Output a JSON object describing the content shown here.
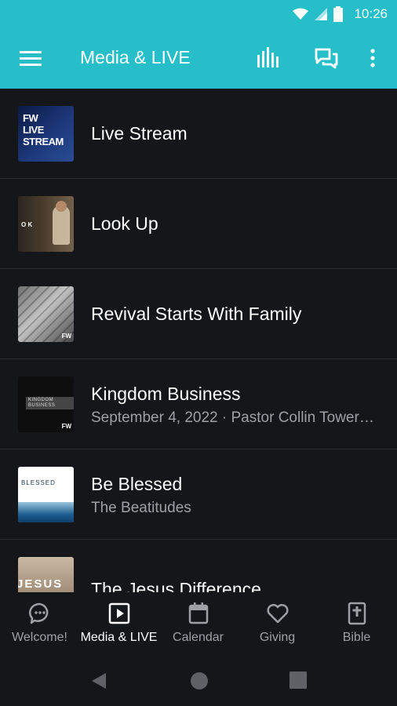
{
  "status_bar": {
    "time": "10:26"
  },
  "app_bar": {
    "title": "Media & LIVE"
  },
  "thumbnails": {
    "live_line1": "FW",
    "live_line2": "LIVE",
    "live_line3": "STREAM",
    "look_text": "O K",
    "fw": "FW",
    "kingdom_line1": "KINGDOM",
    "kingdom_line2": "BUSINESS",
    "blessed": "BLESSED",
    "jesus": "JESUS"
  },
  "items": [
    {
      "title": "Live Stream"
    },
    {
      "title": "Look Up"
    },
    {
      "title": "Revival Starts With Family"
    },
    {
      "title": "Kingdom Business",
      "subtitle": "September 4, 2022 · Pastor Collin Tower…"
    },
    {
      "title": "Be Blessed",
      "subtitle": "The Beatitudes"
    },
    {
      "title": "The Jesus Difference"
    }
  ],
  "bottom_nav": {
    "tabs": [
      {
        "label": "Welcome!",
        "icon": "chat-bubble-icon"
      },
      {
        "label": "Media & LIVE",
        "icon": "play-icon",
        "active": true
      },
      {
        "label": "Calendar",
        "icon": "calendar-icon"
      },
      {
        "label": "Giving",
        "icon": "heart-icon"
      },
      {
        "label": "Bible",
        "icon": "bible-icon"
      }
    ]
  },
  "colors": {
    "accent": "#26bec8",
    "background": "#151619",
    "muted_text": "#9ea0a5"
  }
}
